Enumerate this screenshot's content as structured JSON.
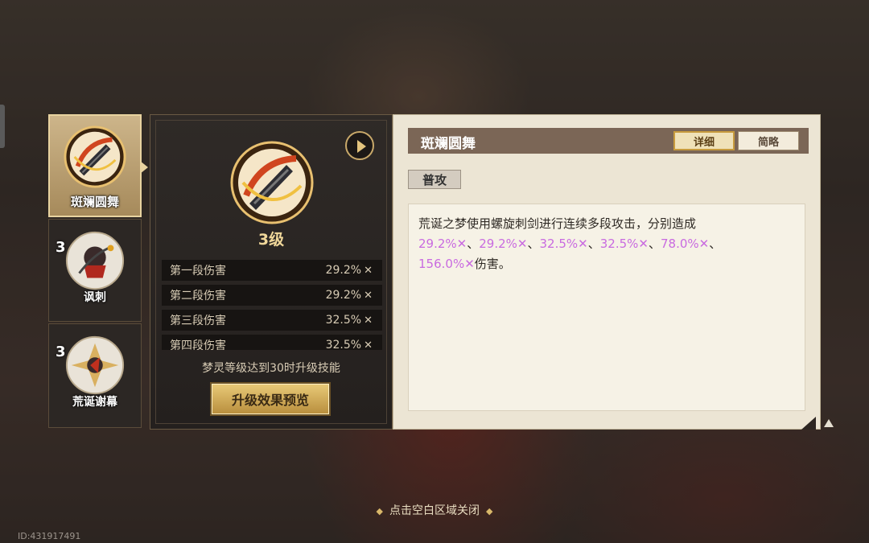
{
  "skills": [
    {
      "name": "斑斓圆舞",
      "level": "",
      "active": true
    },
    {
      "name": "讽刺",
      "level": "3",
      "active": false
    },
    {
      "name": "荒诞谢幕",
      "level": "3",
      "active": false
    }
  ],
  "detail": {
    "level_label": "3级",
    "stats": [
      {
        "label": "第一段伤害",
        "value": "29.2%"
      },
      {
        "label": "第二段伤害",
        "value": "29.2%"
      },
      {
        "label": "第三段伤害",
        "value": "32.5%"
      },
      {
        "label": "第四段伤害",
        "value": "32.5%"
      }
    ],
    "requirement": "梦灵等级达到30时升级技能",
    "preview_button": "升级效果预览"
  },
  "info": {
    "title": "斑斓圆舞",
    "toggle_detail": "详细",
    "toggle_brief": "简略",
    "skill_type": "普攻",
    "desc_prefix": "荒诞之梦使用螺旋刺剑进行连续多段攻击，分别造成",
    "desc_values": [
      "29.2%",
      "29.2%",
      "32.5%",
      "32.5%",
      "78.0%",
      "156.0%"
    ],
    "desc_suffix": "伤害。",
    "separator": "、",
    "multiplier_icon": "✕"
  },
  "close_hint": "点击空白区域关闭",
  "uid": "ID:431917491",
  "colors": {
    "accent_gold": "#e3c47e",
    "highlight": "#c96be0",
    "title_bar": "#7b6656"
  }
}
